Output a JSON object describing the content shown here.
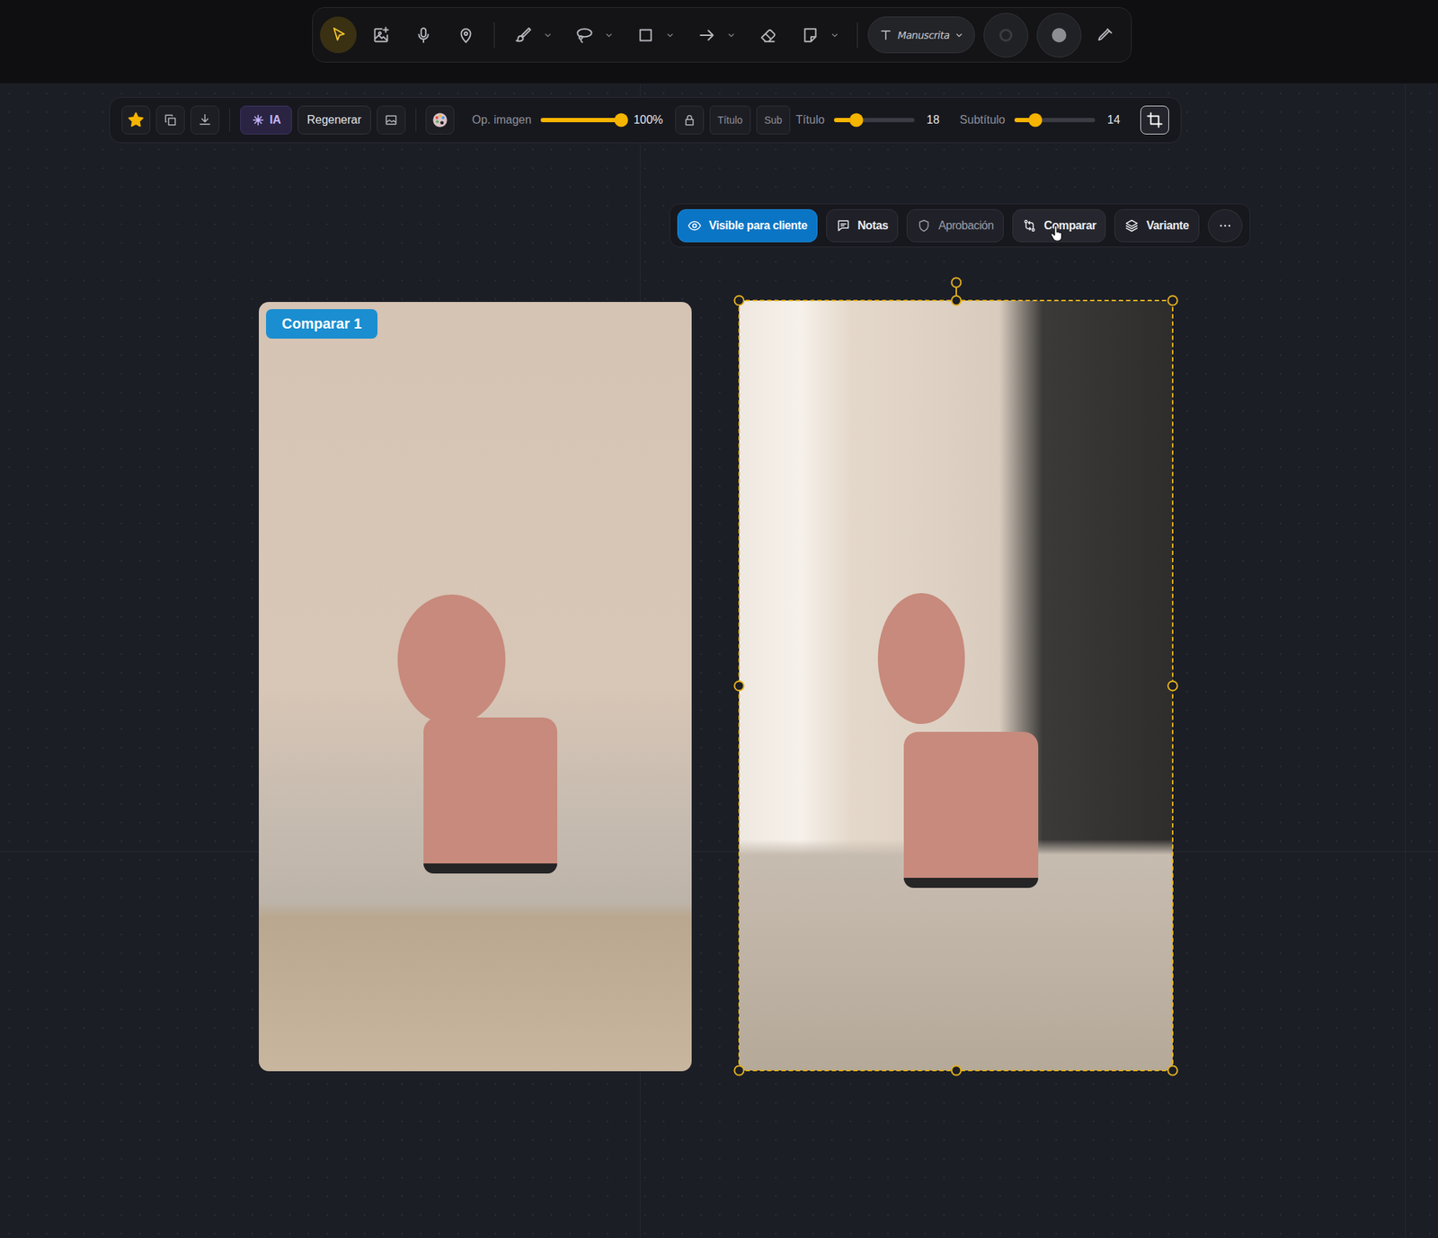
{
  "top_toolbar": {
    "tool_groups": [
      [
        {
          "selected": true,
          "menu": false
        },
        {
          "selected": false,
          "menu": false
        },
        {
          "selected": false,
          "menu": false
        },
        {
          "selected": false,
          "menu": false
        }
      ],
      [
        {
          "selected": false,
          "menu": true
        },
        {
          "selected": false,
          "menu": true
        },
        {
          "selected": false,
          "menu": true
        },
        {
          "selected": false,
          "menu": true
        },
        {
          "selected": false,
          "menu": false
        },
        {
          "selected": false,
          "menu": true
        }
      ]
    ],
    "font_select": {
      "value": "Manuscrita"
    },
    "swatches": [
      {
        "kind": "ring",
        "color": "#3b3c40"
      },
      {
        "kind": "fill",
        "color": "#8d8e93"
      }
    ]
  },
  "properties_bar": {
    "favorite": {
      "on": true
    },
    "ai_button": "IA",
    "regenerate_button": "Regenerar",
    "image_opacity": {
      "label": "Op. imagen",
      "level": 1,
      "reading": "100%"
    },
    "lock": {
      "on": false
    },
    "text_toggles": [
      {
        "label": "Título",
        "on": false
      },
      {
        "label": "Sub",
        "on": false
      }
    ],
    "title_size": {
      "label": "Título",
      "level": 0.28,
      "reading": "18"
    },
    "subtitle_size": {
      "label": "Subtítulo",
      "level": 0.26,
      "reading": "14"
    },
    "crop": {
      "on": true
    }
  },
  "action_bar": {
    "buttons": [
      {
        "label": "Visible para cliente",
        "selected": true,
        "disabled": false,
        "hovered": false
      },
      {
        "label": "Notas",
        "selected": false,
        "disabled": false,
        "hovered": false
      },
      {
        "label": "Aprobación",
        "selected": false,
        "disabled": true,
        "hovered": false
      },
      {
        "label": "Comparar",
        "selected": false,
        "disabled": false,
        "hovered": true
      },
      {
        "label": "Variante",
        "selected": false,
        "disabled": false,
        "hovered": false
      }
    ]
  },
  "canvas": {
    "images": [
      {
        "badge": "Comparar 1",
        "selected": false
      },
      {
        "selected": true
      }
    ]
  }
}
